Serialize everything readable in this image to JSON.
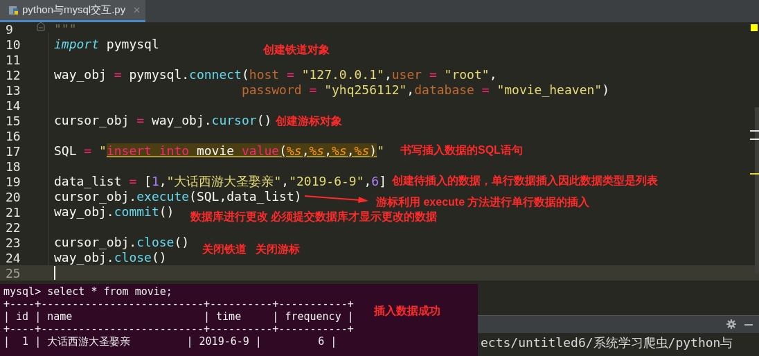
{
  "tab": {
    "title": "python与mysql交互.py",
    "selected": true
  },
  "editor": {
    "lines": [
      {
        "number": "9",
        "current": false,
        "tokens": [
          {
            "text": "\"\"\"",
            "kind": "comment"
          }
        ]
      },
      {
        "number": "10",
        "current": false,
        "tokens": [
          {
            "text": "import",
            "kind": "keyword"
          },
          {
            "text": " pymysql",
            "kind": "plain"
          }
        ]
      },
      {
        "number": "11",
        "current": false
      },
      {
        "number": "12",
        "current": false,
        "tokens": [
          {
            "text": "way_obj ",
            "kind": "plain"
          },
          {
            "text": "=",
            "kind": "op"
          },
          {
            "text": " pymysql.",
            "kind": "plain"
          },
          {
            "text": "connect",
            "kind": "func"
          },
          {
            "text": "(",
            "kind": "plain"
          },
          {
            "text": "host",
            "kind": "param"
          },
          {
            "text": " = ",
            "kind": "op"
          },
          {
            "text": "\"127.0.0.1\"",
            "kind": "string"
          },
          {
            "text": ",",
            "kind": "plain"
          },
          {
            "text": "user",
            "kind": "param"
          },
          {
            "text": " = ",
            "kind": "op"
          },
          {
            "text": "\"root\"",
            "kind": "string"
          },
          {
            "text": ",",
            "kind": "plain"
          }
        ]
      },
      {
        "number": "13",
        "current": false,
        "tokens": [
          {
            "text": "                         password",
            "kind": "param"
          },
          {
            "text": " = ",
            "kind": "op"
          },
          {
            "text": "\"yhq256112\"",
            "kind": "string"
          },
          {
            "text": ",",
            "kind": "plain"
          },
          {
            "text": "database",
            "kind": "param"
          },
          {
            "text": " = ",
            "kind": "op"
          },
          {
            "text": "\"movie_heaven\"",
            "kind": "string"
          },
          {
            "text": ")",
            "kind": "plain"
          }
        ]
      },
      {
        "number": "14",
        "current": false
      },
      {
        "number": "15",
        "current": false,
        "tokens": [
          {
            "text": "cursor_obj ",
            "kind": "plain"
          },
          {
            "text": "=",
            "kind": "op"
          },
          {
            "text": " way_obj.",
            "kind": "plain"
          },
          {
            "text": "cursor",
            "kind": "func"
          },
          {
            "text": "()",
            "kind": "plain"
          }
        ]
      },
      {
        "number": "16",
        "current": false
      },
      {
        "number": "17",
        "current": false,
        "tokens": [
          {
            "text": "SQL ",
            "kind": "plain"
          },
          {
            "text": "=",
            "kind": "op"
          },
          {
            "text": " \"",
            "kind": "string"
          },
          {
            "text": "insert into",
            "kind": "sqlkw"
          },
          {
            "text": " movie ",
            "kind": "sql"
          },
          {
            "text": "value",
            "kind": "sqlkw"
          },
          {
            "text": "(",
            "kind": "sql"
          },
          {
            "text": "%s",
            "kind": "fmt"
          },
          {
            "text": ",",
            "kind": "sql"
          },
          {
            "text": "%s",
            "kind": "fmt"
          },
          {
            "text": ",",
            "kind": "sql"
          },
          {
            "text": "%s",
            "kind": "fmt"
          },
          {
            "text": ",",
            "kind": "sql"
          },
          {
            "text": "%s",
            "kind": "fmt"
          },
          {
            "text": ")",
            "kind": "sql"
          },
          {
            "text": "\"",
            "kind": "string"
          }
        ]
      },
      {
        "number": "18",
        "current": false
      },
      {
        "number": "19",
        "current": false,
        "tokens": [
          {
            "text": "data_list ",
            "kind": "plain"
          },
          {
            "text": "=",
            "kind": "op"
          },
          {
            "text": " [",
            "kind": "plain"
          },
          {
            "text": "1",
            "kind": "number"
          },
          {
            "text": ",",
            "kind": "plain"
          },
          {
            "text": "\"大话西游大圣娶亲\"",
            "kind": "string"
          },
          {
            "text": ",",
            "kind": "plain"
          },
          {
            "text": "\"2019-6-9\"",
            "kind": "string"
          },
          {
            "text": ",",
            "kind": "plain"
          },
          {
            "text": "6",
            "kind": "number"
          },
          {
            "text": "]",
            "kind": "plain"
          }
        ]
      },
      {
        "number": "20",
        "current": false,
        "tokens": [
          {
            "text": "cursor_obj.",
            "kind": "plain"
          },
          {
            "text": "execute",
            "kind": "func"
          },
          {
            "text": "(SQL,data_list)",
            "kind": "plain"
          }
        ]
      },
      {
        "number": "21",
        "current": false,
        "tokens": [
          {
            "text": "way_obj.",
            "kind": "plain"
          },
          {
            "text": "commit",
            "kind": "func"
          },
          {
            "text": "()",
            "kind": "plain"
          }
        ]
      },
      {
        "number": "22",
        "current": false
      },
      {
        "number": "23",
        "current": false,
        "tokens": [
          {
            "text": "cursor_obj.",
            "kind": "plain"
          },
          {
            "text": "close",
            "kind": "func"
          },
          {
            "text": "()",
            "kind": "plain"
          }
        ]
      },
      {
        "number": "24",
        "current": false,
        "tokens": [
          {
            "text": "way_obj.",
            "kind": "plain"
          },
          {
            "text": "close",
            "kind": "func"
          },
          {
            "text": "()",
            "kind": "plain"
          }
        ]
      },
      {
        "number": "25",
        "current": true
      }
    ]
  },
  "annotations": [
    {
      "text": "创建铁道对象"
    },
    {
      "text": "创建游标对象"
    },
    {
      "text": "书写插入数据的SQL语句"
    },
    {
      "text": "创建待插入的数据，单行数据插入因此数据类型是列表"
    },
    {
      "text": "游标利用 execute 方法进行单行数据的插入"
    },
    {
      "text": "数据库进行更改 必须提交数据库才显示更改的数据"
    },
    {
      "text": "关闭铁道   关闭游标"
    },
    {
      "text": "插入数据成功"
    }
  ],
  "run_panel": {
    "path": "ects/untitled6/系统学习爬虫/python与"
  },
  "terminal": {
    "lines": [
      "mysql> select * from movie;",
      "+----+--------------------------+----------+-----------+",
      "| id | name                     | time     | frequency |",
      "+----+--------------------------+----------+-----------+",
      "|  1 | 大话西游大圣娶亲         | 2019-6-9 |         6 |"
    ]
  }
}
